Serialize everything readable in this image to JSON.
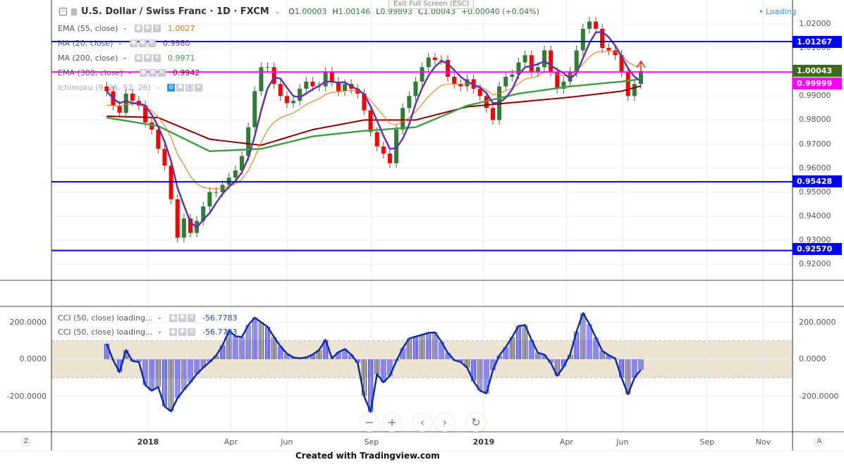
{
  "header": {
    "title": "U.S. Dollar / Swiss Franc · 1D · FXCM",
    "ohlc": [
      {
        "label": "O",
        "value": "1.00003"
      },
      {
        "label": "H",
        "value": "1.00146"
      },
      {
        "label": "L",
        "value": "0.99893"
      },
      {
        "label": "C",
        "value": "1.00043"
      }
    ],
    "change": "+0.00040 (+0.04%)",
    "tooltip": "Exit Full Screen (ESC)",
    "loading": "Loading"
  },
  "indicators": [
    {
      "name": "EMA (55, close)",
      "value": "1.0027",
      "color": "#ff6d00"
    },
    {
      "name": "MA (20, close)",
      "value": "0.9980",
      "color": "#5e35b1"
    },
    {
      "name": "MA (200, close)",
      "value": "0.9971",
      "color": "#43a047"
    },
    {
      "name": "EMA (300, close)",
      "value": "0.9942",
      "color": "#8b0000"
    },
    {
      "name": "Ichimoku (9, 26, 52, 26)",
      "value": "",
      "color": "#999999"
    }
  ],
  "cci_legends": [
    {
      "name": "CCI (50, close) loading...",
      "value": "-56.7783"
    },
    {
      "name": "CCI (50, close) loading...",
      "value": "-56.7783"
    }
  ],
  "price_badges": [
    {
      "value": "1.01267",
      "color": "#0000ff"
    },
    {
      "value": "1.00043",
      "color": "#3a6b1e"
    },
    {
      "value": "0.99999",
      "color": "#ff00ff"
    },
    {
      "value": "0.95428",
      "color": "#0000ff"
    },
    {
      "value": "0.92570",
      "color": "#0000ff"
    }
  ],
  "navigation": {
    "zoom_out": "−",
    "zoom_in": "+",
    "back": "‹",
    "forward": "›",
    "reset": "↻",
    "z_label": "Z",
    "a_label": "A"
  },
  "footer": "Created with Tradingview.com",
  "chart_data": [
    {
      "type": "candlestick",
      "title": "U.S. Dollar / Swiss Franc · 1D · FXCM",
      "sampling": "weekly approximation of daily candles",
      "start_date": "2017-11-17",
      "step_days": 7,
      "closes": [
        0.992,
        0.986,
        0.983,
        0.991,
        0.988,
        0.986,
        0.979,
        0.976,
        0.968,
        0.961,
        0.947,
        0.931,
        0.939,
        0.933,
        0.938,
        0.944,
        0.95,
        0.95,
        0.953,
        0.956,
        0.959,
        0.965,
        0.977,
        0.992,
        1.002,
        1.002,
        0.995,
        0.99,
        0.987,
        0.988,
        0.993,
        0.996,
        0.994,
        0.994,
        1.0,
        0.996,
        0.992,
        0.995,
        0.993,
        0.991,
        0.984,
        0.975,
        0.969,
        0.966,
        0.962,
        0.976,
        0.985,
        0.99,
        0.996,
        1.002,
        1.006,
        1.005,
        1.005,
        0.998,
        0.995,
        0.994,
        0.997,
        0.993,
        0.99,
        0.985,
        0.98,
        0.994,
        0.998,
        0.999,
        1.004,
        1.007,
        1.0,
        1.002,
        1.009,
        1.0,
        0.993,
        0.996,
        1.0,
        1.009,
        1.018,
        1.021,
        1.018,
        1.01,
        1.009,
        1.007,
        1.0,
        0.99,
        0.995,
        1.0004
      ],
      "ma200_samples": {
        "index": [
          0,
          8,
          16,
          24,
          32,
          40,
          48,
          56,
          64,
          72,
          80,
          83
        ],
        "values": [
          0.981,
          0.9775,
          0.967,
          0.968,
          0.9732,
          0.9755,
          0.977,
          0.986,
          0.991,
          0.994,
          0.996,
          0.9971
        ]
      },
      "ema300_samples": {
        "index": [
          0,
          8,
          16,
          24,
          32,
          40,
          48,
          56,
          64,
          72,
          80,
          83
        ],
        "values": [
          0.9816,
          0.981,
          0.972,
          0.9695,
          0.976,
          0.98,
          0.98,
          0.9855,
          0.9875,
          0.9895,
          0.992,
          0.9942
        ]
      },
      "ma20_period_weeks": 4,
      "ema55_period_weeks": 11,
      "horizontal_lines": [
        {
          "value": 1.01267,
          "color": "#0000ff"
        },
        {
          "value": 0.99999,
          "color": "#ff00ff"
        },
        {
          "value": 0.95428,
          "color": "#0000ff"
        },
        {
          "value": 0.9257,
          "color": "#0000ff"
        }
      ],
      "ylim": [
        0.915,
        1.028
      ],
      "y_ticks": [
        "1.02000",
        "1.01000",
        "0.99000",
        "0.98000",
        "0.97000",
        "0.96000",
        "0.95000",
        "0.94000",
        "0.93000",
        "0.92000"
      ],
      "x_ticks": [
        {
          "label": "2018",
          "date": "2018-01-01",
          "bold": true
        },
        {
          "label": "Apr",
          "date": "2018-04-01"
        },
        {
          "label": "Jun",
          "date": "2018-06-01"
        },
        {
          "label": "Sep",
          "date": "2018-09-01"
        },
        {
          "label": "2019",
          "date": "2019-01-01",
          "bold": true
        },
        {
          "label": "Apr",
          "date": "2019-04-01"
        },
        {
          "label": "Jun",
          "date": "2019-06-01"
        },
        {
          "label": "Sep",
          "date": "2019-09-01"
        },
        {
          "label": "Nov",
          "date": "2019-11-01"
        }
      ]
    },
    {
      "type": "bar",
      "title": "CCI (50, close)",
      "start_date": "2017-11-17",
      "step_days": 7,
      "values": [
        84,
        -5,
        -70,
        50,
        -10,
        -15,
        -140,
        -170,
        -150,
        -255,
        -282,
        -210,
        -165,
        -125,
        -80,
        -45,
        -15,
        20,
        75,
        155,
        125,
        120,
        185,
        225,
        200,
        175,
        120,
        70,
        30,
        10,
        5,
        10,
        25,
        50,
        105,
        5,
        38,
        55,
        25,
        -20,
        -200,
        -285,
        -80,
        -125,
        -90,
        -10,
        60,
        112,
        122,
        132,
        143,
        145,
        95,
        35,
        -5,
        -15,
        -45,
        -120,
        -170,
        -185,
        -60,
        20,
        65,
        120,
        180,
        185,
        105,
        35,
        25,
        -20,
        -90,
        -40,
        25,
        150,
        250,
        190,
        118,
        45,
        22,
        5,
        -100,
        -190,
        -100,
        -57
      ],
      "band": [
        -100,
        100
      ],
      "ylim": [
        -320,
        290
      ],
      "y_ticks": [
        "200.0000",
        "0.0000",
        "-200.0000"
      ]
    }
  ]
}
